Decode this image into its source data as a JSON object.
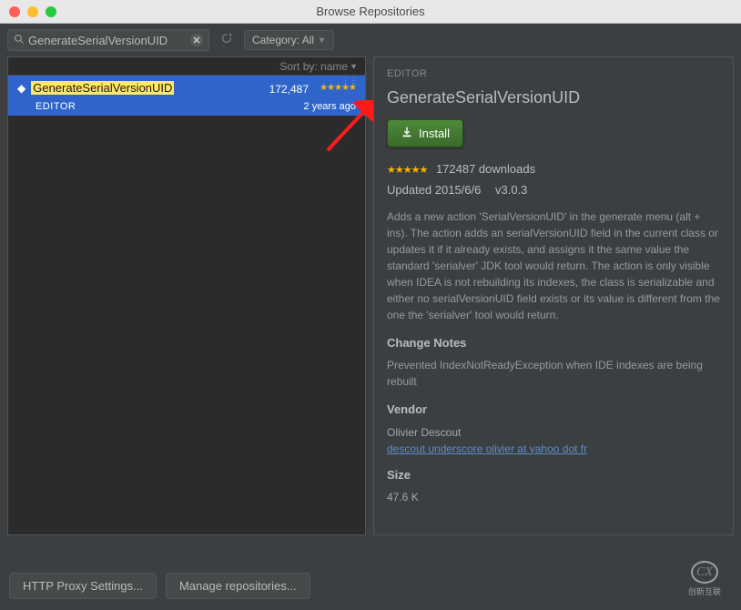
{
  "window": {
    "title": "Browse Repositories"
  },
  "toolbar": {
    "search_value": "GenerateSerialVersionUID",
    "category_label": "Category: All"
  },
  "left": {
    "sort_label": "Sort by: name",
    "items": [
      {
        "name": "GenerateSerialVersionUID",
        "downloads": "172,487",
        "category": "EDITOR",
        "time": "2 years ago"
      }
    ]
  },
  "detail": {
    "category": "EDITOR",
    "title": "GenerateSerialVersionUID",
    "install_label": "Install",
    "downloads_text": "172487 downloads",
    "updated_text": "Updated 2015/6/6",
    "version": "v3.0.3",
    "description": "Adds a new action 'SerialVersionUID' in the generate menu (alt + ins). The action adds an serialVersionUID field in the current class or updates it if it already exists, and assigns it the same value the standard 'serialver' JDK tool would return. The action is only visible when IDEA is not rebuilding its indexes, the class is serializable and either no serialVersionUID field exists or its value is different from the one the 'serialver' tool would return.",
    "change_notes_heading": "Change Notes",
    "change_notes_body": "Prevented IndexNotReadyException when IDE indexes are being rebuilt",
    "vendor_heading": "Vendor",
    "vendor_name": "Olivier Descout",
    "vendor_link": "descout underscore olivier at yahoo dot fr",
    "size_heading": "Size",
    "size_value": "47.6 K"
  },
  "footer": {
    "proxy_btn": "HTTP Proxy Settings...",
    "manage_btn": "Manage repositories..."
  },
  "watermark": {
    "text": "创新互联"
  }
}
